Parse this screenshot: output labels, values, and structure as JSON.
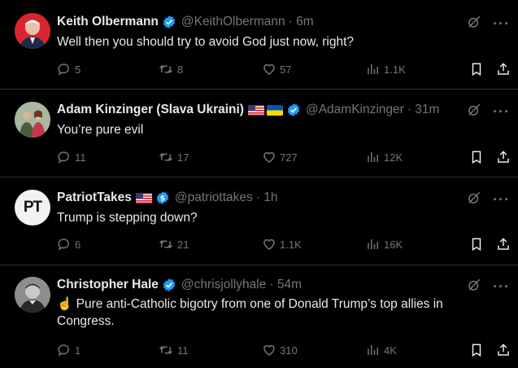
{
  "tweets": [
    {
      "name": "Keith Olbermann",
      "handle": "@KeithOlbermann",
      "time": "· 6m",
      "text": "Well then you should try to avoid God just now, right?",
      "replies": "5",
      "retweets": "8",
      "likes": "57",
      "views": "1.1K",
      "avatar": "keith-avatar"
    },
    {
      "name": "Adam Kinzinger (Slava Ukraini)",
      "handle": "@AdamKinzinger",
      "time": "· 31m",
      "text": "You’re pure evil",
      "replies": "11",
      "retweets": "17",
      "likes": "727",
      "views": "12K",
      "avatar": "adam-avatar"
    },
    {
      "name": "PatriotTakes",
      "handle": "@patriottakes",
      "time": "· 1h",
      "text": "Trump is stepping down?",
      "replies": "6",
      "retweets": "21",
      "likes": "1.1K",
      "views": "16K",
      "avatar_text": "PT"
    },
    {
      "name": "Christopher Hale",
      "handle": "@chrisjollyhale",
      "time": "· 54m",
      "text_emoji": "☝️",
      "text": "Pure anti-Catholic bigotry from one of Donald Trump’s top allies in Congress.",
      "replies": "1",
      "retweets": "11",
      "likes": "310",
      "views": "4K",
      "avatar": "chris-avatar"
    }
  ],
  "colors": {
    "background": "#000000",
    "text": "#e7e9ea",
    "muted": "#71767b",
    "verified_blue": "#1d9bf0",
    "divider": "#2f3336"
  },
  "icons": {
    "reply": "reply-icon",
    "retweet": "retweet-icon",
    "like": "like-icon",
    "views": "views-icon",
    "bookmark": "bookmark-icon",
    "share": "share-icon",
    "grok": "grok-icon",
    "more": "more-icon"
  }
}
